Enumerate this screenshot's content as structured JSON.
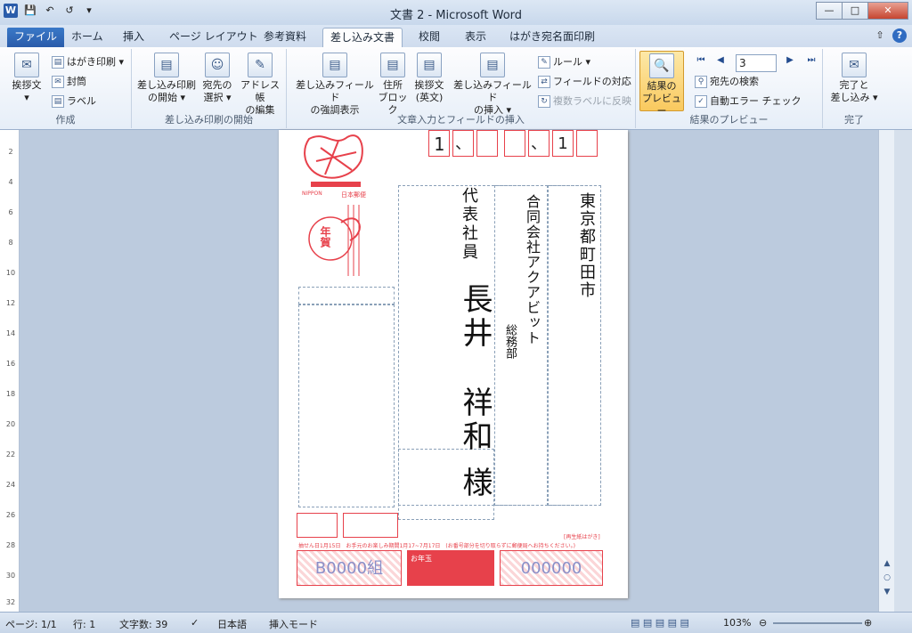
{
  "window": {
    "title": "文書 2 - Microsoft Word",
    "quick_access": [
      "W",
      "save",
      "undo",
      "redo"
    ]
  },
  "tabs": {
    "file": "ファイル",
    "home": "ホーム",
    "insert": "挿入",
    "page_layout": "ページ レイアウト",
    "references": "参考資料",
    "mailings": "差し込み文書",
    "review": "校閲",
    "view": "表示",
    "postcard": "はがき宛名面印刷"
  },
  "ribbon": {
    "create": {
      "greeting_card": "挨拶文",
      "postcard_print": "はがき印刷",
      "envelope": "封筒",
      "label": "ラベル",
      "group": "作成"
    },
    "start": {
      "start_merge": "差し込み印刷",
      "start_merge2": "の開始",
      "select_recipients": "宛先の",
      "select_recipients2": "選択",
      "edit_address": "アドレス帳",
      "edit_address2": "の編集",
      "group": "差し込み印刷の開始"
    },
    "write": {
      "highlight": "差し込みフィールド",
      "highlight2": "の強調表示",
      "address_block": "住所",
      "address_block2": "ブロック",
      "greeting_line": "挨拶文",
      "greeting_line2": "(英文)",
      "insert_field": "差し込みフィールド",
      "insert_field2": "の挿入",
      "rules": "ルール",
      "match_fields": "フィールドの対応",
      "update_labels": "複数ラベルに反映",
      "group": "文章入力とフィールドの挿入"
    },
    "preview": {
      "preview_results": "結果の",
      "preview_results2": "プレビュー",
      "record": "3",
      "find_recipient": "宛先の検索",
      "auto_check": "自動エラー チェック",
      "group": "結果のプレビュー"
    },
    "finish": {
      "finish_merge": "完了と",
      "finish_merge2": "差し込み",
      "group": "完了"
    }
  },
  "postcard": {
    "zip_digits": [
      "1",
      "、",
      "",
      "",
      "、",
      "1",
      ""
    ],
    "address": "東京都町田市",
    "company": "合同会社アクアビット",
    "department": "総務部",
    "title": "代表社員",
    "name_last": "長井",
    "name_first": "祥和",
    "honorific": "様",
    "lottery_group": "B0000組",
    "lottery_number": "000000",
    "nenga": "年賀",
    "nippon": "NIPPON",
    "stamp_text": "日本郵便",
    "recycled": "[再生紙はがき]",
    "footer_note": "抽せん日1月15日　お手元のお楽しみ期間1月17~7月17日　(お番号部分を切り取らずに郵便局へお持ちください。)",
    "otoshidama": "お年玉"
  },
  "ruler": {
    "marks": [
      "2",
      "4",
      "6",
      "8",
      "10",
      "12",
      "14",
      "16",
      "18",
      "20",
      "22",
      "24",
      "26",
      "28",
      "30",
      "32"
    ]
  },
  "status": {
    "page": "ページ: 1/1",
    "line": "行: 1",
    "words": "文字数: 39",
    "lang": "日本語",
    "mode": "挿入モード",
    "zoom": "103%"
  }
}
